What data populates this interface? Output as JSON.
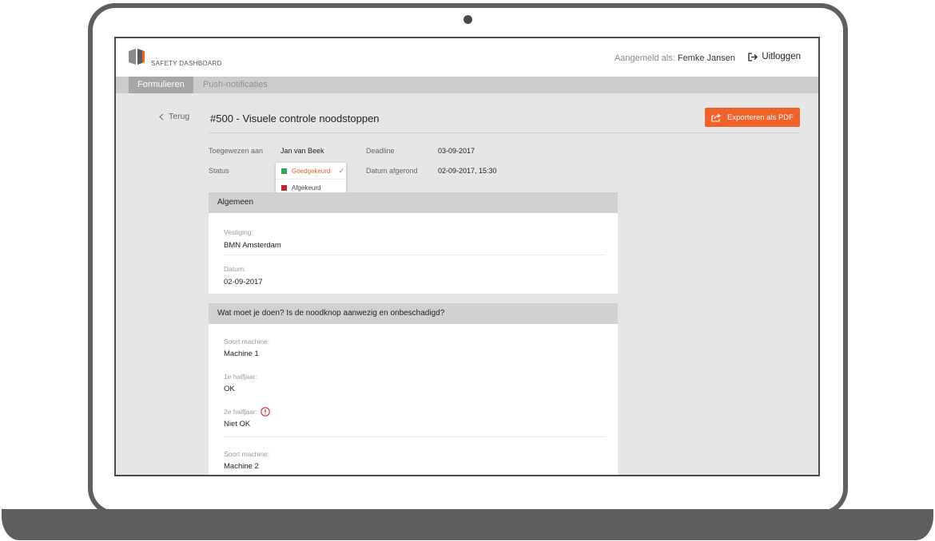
{
  "app": {
    "brand": "SAFETY DASHBOARD",
    "logged_in_label": "Aangemeld als:",
    "user_name": "Femke Jansen",
    "logout_label": "Uitloggen"
  },
  "tabs": [
    {
      "label": "Formulieren",
      "active": true
    },
    {
      "label": "Push-notificaties",
      "active": false
    }
  ],
  "page": {
    "back_label": "Terug",
    "title": "#500 - Visuele controle noodstoppen",
    "export_label": "Exporteren als PDF"
  },
  "meta": {
    "assigned_label": "Toegewezen aan",
    "assigned_value": "Jan van Beek",
    "status_label": "Status",
    "deadline_label": "Deadline",
    "deadline_value": "03-09-2017",
    "completed_label": "Datum afgerond",
    "completed_value": "02-09-2017, 15:30"
  },
  "status_dropdown": {
    "options": [
      {
        "label": "Goedgekeurd",
        "selected": true,
        "color": "#2ea84a"
      },
      {
        "label": "Afgekeurd",
        "selected": false,
        "color": "#c0272d"
      }
    ]
  },
  "sections": [
    {
      "title": "Algemeen",
      "fields": [
        {
          "label": "Vestiging:",
          "value": "BMN Amsterdam"
        },
        {
          "label": "Datum:",
          "value": "02-09-2017"
        }
      ]
    },
    {
      "title": "Wat moet je doen? Is de noodknop aanwezig en onbeschadigd?",
      "fields": [
        {
          "label": "Soort machine:",
          "value": "Machine 1"
        },
        {
          "label": "1e halfjaar:",
          "value": "OK"
        },
        {
          "label": "2e halfjaar:",
          "value": "Niet OK",
          "warning": true
        },
        {
          "label": "Soort machine:",
          "value": "Machine 2"
        }
      ]
    }
  ],
  "colors": {
    "accent": "#f0622a",
    "approved": "#2ea84a",
    "rejected": "#c0272d",
    "warning": "#e0272d"
  }
}
